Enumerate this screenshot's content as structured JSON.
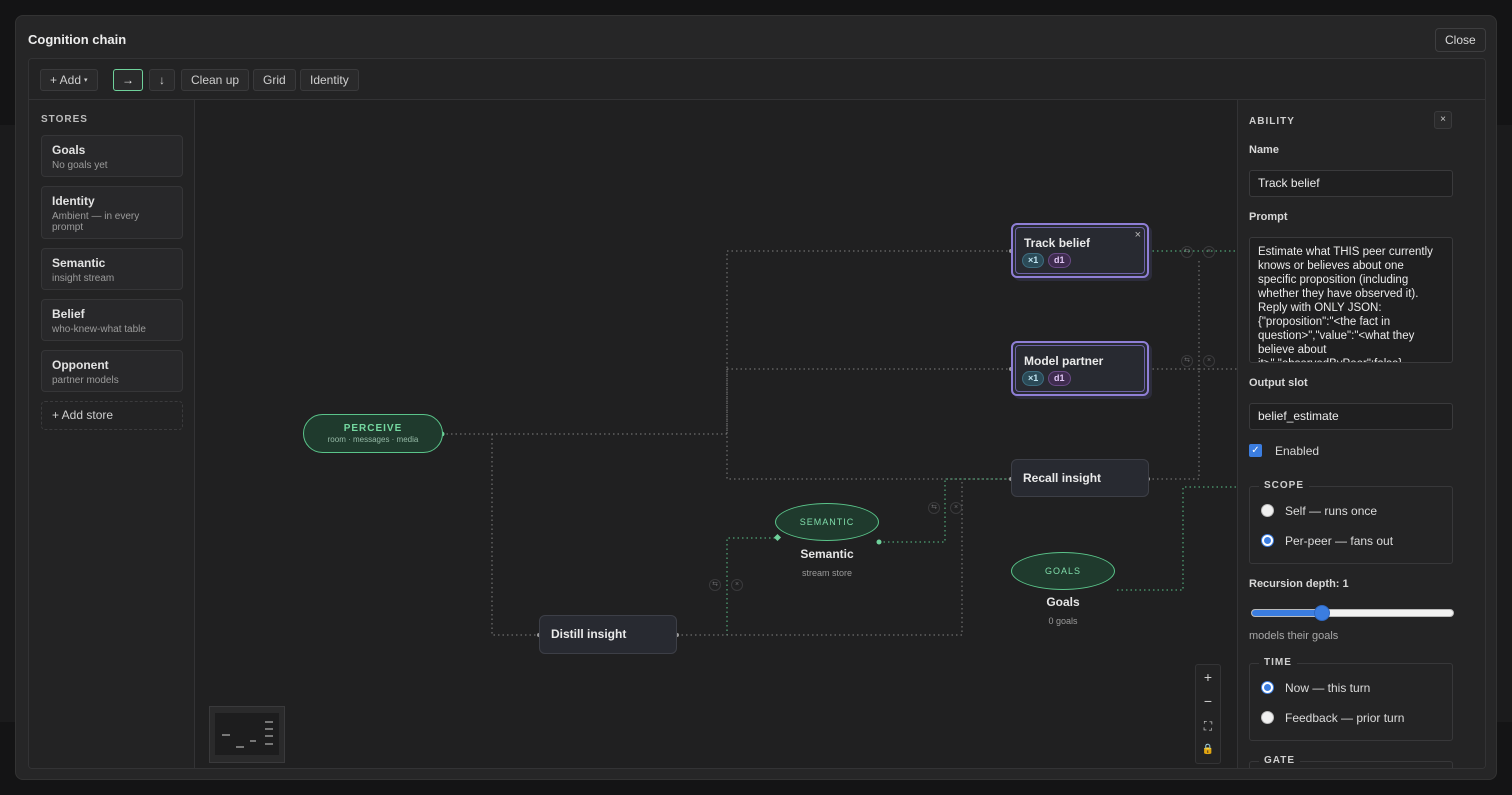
{
  "modal": {
    "title": "Cognition chain",
    "close_label": "Close"
  },
  "toolbar": {
    "add_label": "+ Add",
    "add_caret": "▾",
    "dir_right": "→",
    "dir_down": "↓",
    "cleanup_label": "Clean up",
    "grid_label": "Grid",
    "identity_label": "Identity"
  },
  "stores": {
    "heading": "STORES",
    "items": [
      {
        "title": "Goals",
        "subtitle": "No goals yet"
      },
      {
        "title": "Identity",
        "subtitle": "Ambient — in every prompt"
      },
      {
        "title": "Semantic",
        "subtitle": "insight stream"
      },
      {
        "title": "Belief",
        "subtitle": "who-knew-what table"
      },
      {
        "title": "Opponent",
        "subtitle": "partner models"
      }
    ],
    "add_label": "+ Add store"
  },
  "canvas": {
    "perceive": {
      "title": "PERCEIVE",
      "subtitle": "room · messages · media"
    },
    "nodes": {
      "track_belief": {
        "label": "Track belief",
        "badge_count": "×1",
        "badge_depth": "d1",
        "close": "×"
      },
      "model_partner": {
        "label": "Model partner",
        "badge_count": "×1",
        "badge_depth": "d1"
      },
      "recall_insight": {
        "label": "Recall insight"
      },
      "distill_insight": {
        "label": "Distill insight"
      }
    },
    "semantic": {
      "shape_label": "SEMANTIC",
      "title": "Semantic",
      "subtitle": "stream store"
    },
    "goals": {
      "shape_label": "GOALS",
      "title": "Goals",
      "subtitle": "0 goals"
    },
    "edge_icons": {
      "swap": "⇆",
      "remove": "×"
    },
    "zoom": {
      "in": "+",
      "out": "−",
      "fit": "⛶",
      "lock": "🔒"
    }
  },
  "panel": {
    "heading": "ABILITY",
    "close": "×",
    "name_label": "Name",
    "name_value": "Track belief",
    "prompt_label": "Prompt",
    "prompt_value": "Estimate what THIS peer currently knows or believes about one specific proposition (including whether they have observed it). Reply with ONLY JSON: {\"proposition\":\"<the fact in question>\",\"value\":\"<what they believe about it>\",\"observedByPeer\":false}",
    "output_label": "Output slot",
    "output_value": "belief_estimate",
    "enabled_label": "Enabled",
    "enabled": true,
    "scope": {
      "legend": "SCOPE",
      "options": [
        "Self — runs once",
        "Per-peer — fans out"
      ],
      "selected": 1
    },
    "recursion_label": "Recursion depth: 1",
    "recursion_value": 1,
    "recursion_fraction": 0.35,
    "recursion_hint": "models their goals",
    "time": {
      "legend": "TIME",
      "options": [
        "Now — this turn",
        "Feedback — prior turn"
      ],
      "selected": 0
    },
    "gate": {
      "legend": "GATE"
    }
  },
  "colors": {
    "accent_green": "#5ac48a",
    "accent_purple": "#8f7fd6",
    "accent_blue": "#3b7de0"
  }
}
